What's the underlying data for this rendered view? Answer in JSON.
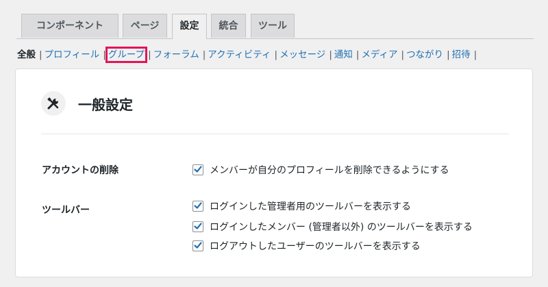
{
  "tabs": [
    {
      "label": "コンポーネント",
      "active": false
    },
    {
      "label": "ページ",
      "active": false
    },
    {
      "label": "設定",
      "active": true
    },
    {
      "label": "統合",
      "active": false
    },
    {
      "label": "ツール",
      "active": false
    }
  ],
  "subnav": {
    "current": "全般",
    "links": [
      "プロフィール",
      "グループ",
      "フォーラム",
      "アクティビティ",
      "メッセージ",
      "通知",
      "メディア",
      "つながり",
      "招待"
    ],
    "highlighted": "グループ",
    "separator": "|"
  },
  "settings_card": {
    "icon": "tools-icon",
    "title": "一般設定",
    "sections": [
      {
        "label": "アカウントの削除",
        "options": [
          {
            "label": "メンバーが自分のプロフィールを削除できるようにする",
            "checked": true
          }
        ]
      },
      {
        "label": "ツールバー",
        "options": [
          {
            "label": "ログインした管理者用のツールバーを表示する",
            "checked": true
          },
          {
            "label": "ログインしたメンバー (管理者以外) のツールバーを表示する",
            "checked": true
          },
          {
            "label": "ログアウトしたユーザーのツールバーを表示する",
            "checked": true
          }
        ]
      }
    ]
  },
  "colors": {
    "link": "#2271b1",
    "highlight_box": "#e31456",
    "checkbox_check": "#2271b1"
  }
}
